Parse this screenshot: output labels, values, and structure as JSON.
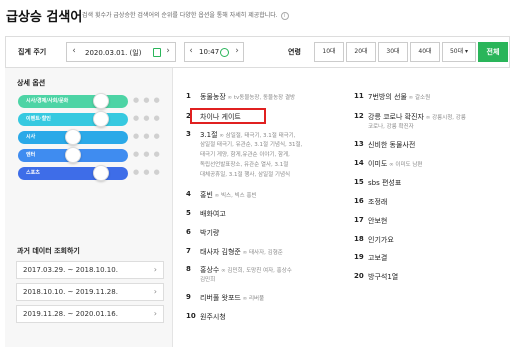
{
  "header": {
    "title": "급상승 검색어",
    "subtitle": "검색 횟수가 급상승한 검색어의 순위를 다양한 옵션을 통해 자세히 제공합니다.",
    "info_icon": "info-icon"
  },
  "filter": {
    "period_label": "집계 주기",
    "date": "2020.03.01. (일)",
    "time": "10:47",
    "age_label": "연령",
    "ages": [
      "10대",
      "20대",
      "30대",
      "40대",
      "50대 ▾"
    ],
    "all_label": "전체",
    "accent": "#2ab55a"
  },
  "sidebar": {
    "title": "상세 옵션",
    "options": [
      {
        "label": "시사/경제/사회/문화",
        "color": "#4dd4a5",
        "level": 0.75
      },
      {
        "label": "이벤트·할인",
        "color": "#36c9e0",
        "level": 0.75
      },
      {
        "label": "시사",
        "color": "#2aa9e8",
        "level": 0.5
      },
      {
        "label": "엔터",
        "color": "#3f8cf0",
        "level": 0.5
      },
      {
        "label": "스포츠",
        "color": "#3e6de8",
        "level": 0.75
      }
    ],
    "past_title": "과거 데이터 조회하기",
    "ranges": [
      "2017.03.29. ~ 2018.10.10.",
      "2018.10.10. ~ 2019.11.28.",
      "2019.11.28. ~ 2020.01.16."
    ]
  },
  "ranking_left": [
    {
      "num": "1",
      "word": "동물농장",
      "rel": [
        "tv동물농장, 동물농장 결방"
      ]
    },
    {
      "num": "2",
      "word": "차이나 게이트",
      "rel": []
    },
    {
      "num": "3",
      "word": "3.1절",
      "rel": [
        "삼일절, 태극기, 3.1절 태극기,",
        "삼일절 태극기, 유관순, 3.1절 기념식, 31절,",
        "태극기 게양, 함게,유관순 이야기, 함게,",
        "독립선언발표장소, 유관순 열사, 3.1절",
        "대체공휴일, 3.1절 행사, 삼일절 기념식"
      ]
    },
    {
      "num": "4",
      "word": "홍빈",
      "rel": [
        "빅스, 빅스 홍빈"
      ]
    },
    {
      "num": "5",
      "word": "배화여고",
      "rel": []
    },
    {
      "num": "6",
      "word": "박기량",
      "rel": []
    },
    {
      "num": "7",
      "word": "태사자 김형준",
      "rel": [
        "태사자, 김형준"
      ]
    },
    {
      "num": "8",
      "word": "홍상수",
      "rel": [
        "김민희, 도망친 여자, 홍상수",
        "김민희"
      ]
    },
    {
      "num": "9",
      "word": "리버풀 왓포드",
      "rel": [
        "리버풀"
      ]
    },
    {
      "num": "10",
      "word": "원주시청",
      "rel": []
    }
  ],
  "ranking_right": [
    {
      "num": "11",
      "word": "7번방의 선물",
      "rel": [
        "갈소원"
      ]
    },
    {
      "num": "12",
      "word": "강릉 코로나 확진자",
      "rel": [
        "강릉시청, 강릉",
        "코로나, 강릉 확진자"
      ]
    },
    {
      "num": "13",
      "word": "신비한 동물사전",
      "rel": []
    },
    {
      "num": "14",
      "word": "이미도",
      "rel": [
        "이미도 남편"
      ]
    },
    {
      "num": "15",
      "word": "sbs 편성표",
      "rel": []
    },
    {
      "num": "16",
      "word": "조정래",
      "rel": []
    },
    {
      "num": "17",
      "word": "안보현",
      "rel": []
    },
    {
      "num": "18",
      "word": "인기가요",
      "rel": []
    },
    {
      "num": "19",
      "word": "고보결",
      "rel": []
    },
    {
      "num": "20",
      "word": "방구석1열",
      "rel": []
    }
  ]
}
